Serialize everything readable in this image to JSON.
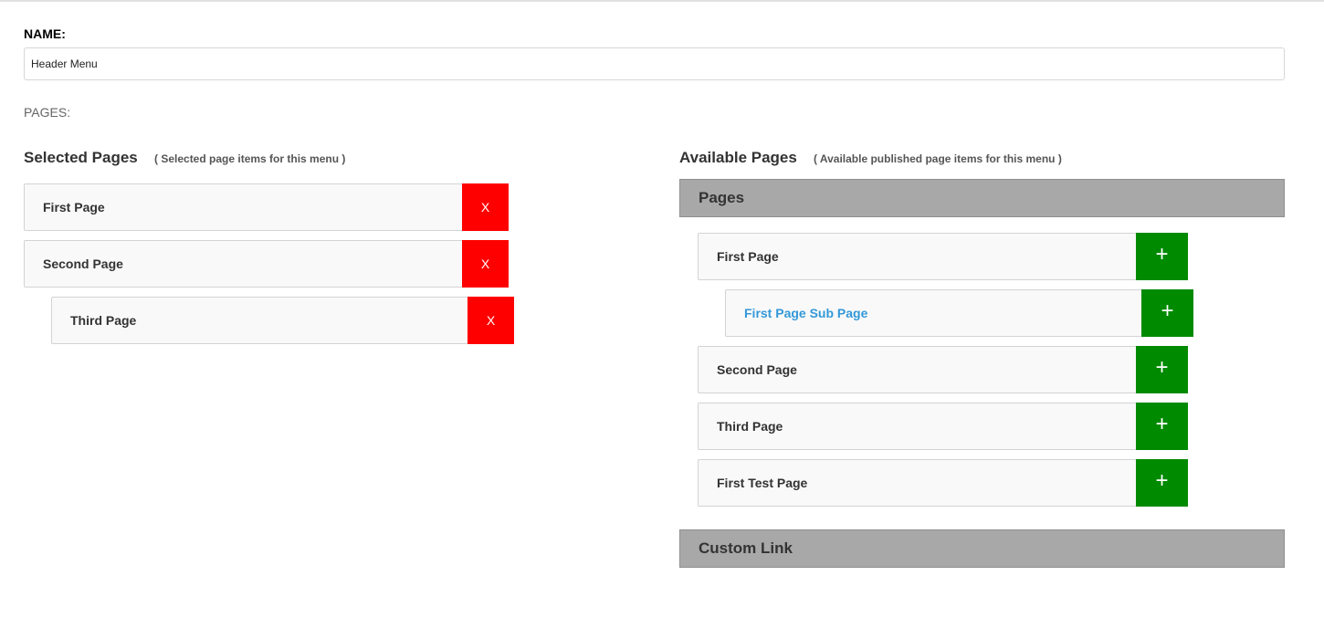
{
  "form": {
    "name_label": "NAME:",
    "name_value": "Header Menu",
    "pages_label": "PAGES:"
  },
  "selected": {
    "title": "Selected Pages",
    "note": "( Selected page items for this menu )",
    "remove_label": "X",
    "items": [
      {
        "label": "First Page"
      },
      {
        "label": "Second Page"
      },
      {
        "label": "Third Page"
      }
    ]
  },
  "available": {
    "title": "Available Pages",
    "note": "( Available published page items for this menu )",
    "pages_header": "Pages",
    "add_label": "+",
    "items": [
      {
        "label": "First Page"
      },
      {
        "label": "First Page Sub Page"
      },
      {
        "label": "Second Page"
      },
      {
        "label": "Third Page"
      },
      {
        "label": "First Test Page"
      }
    ],
    "custom_link_header": "Custom Link"
  },
  "colors": {
    "remove": "#ff0000",
    "add": "#008a00",
    "link": "#3398d8",
    "group_header": "#a8a8a8"
  }
}
